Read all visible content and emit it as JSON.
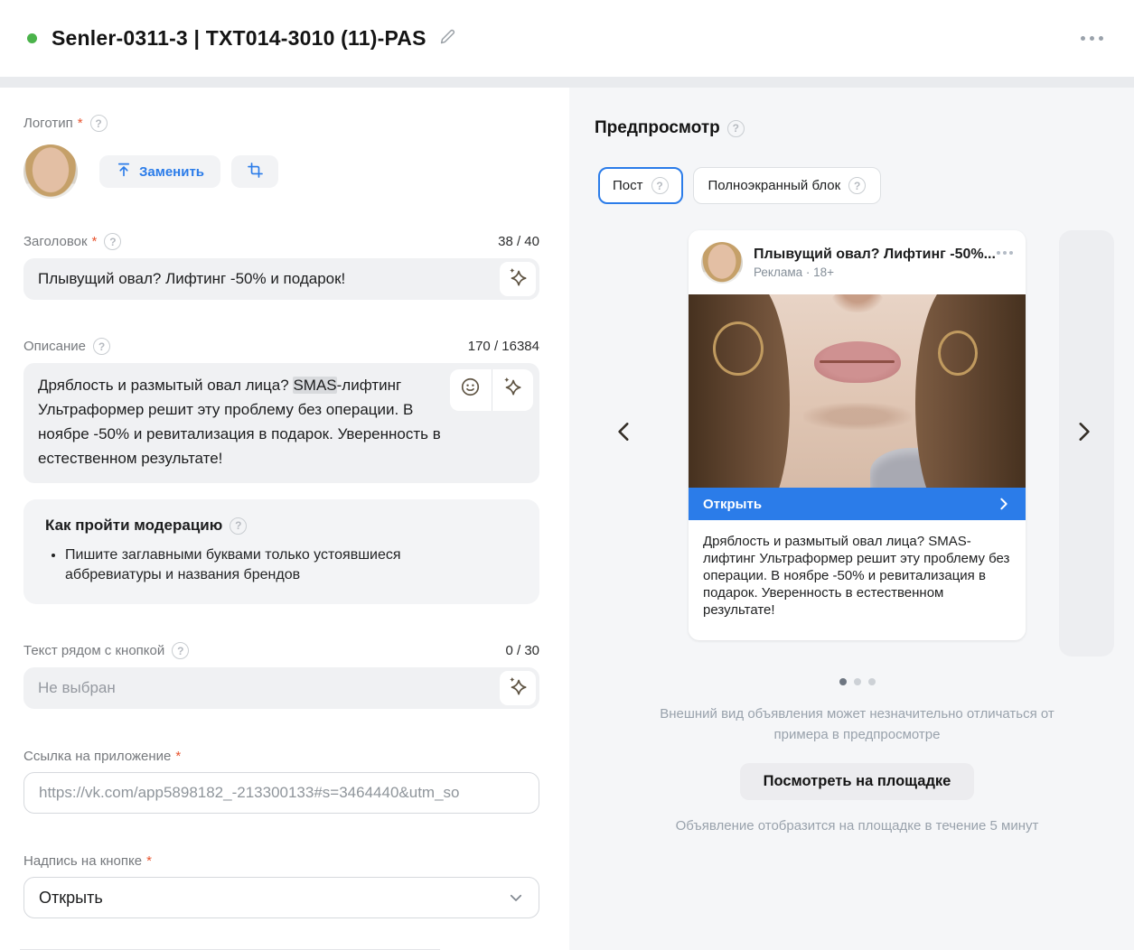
{
  "header": {
    "title": "Senler-0311-3 | TXT014-3010 (11)-PAS"
  },
  "icons": {
    "help": "?"
  },
  "form": {
    "logo": {
      "label": "Логотип",
      "required": "*",
      "replace_button": "Заменить"
    },
    "title_field": {
      "label": "Заголовок",
      "required": "*",
      "counter": "38 / 40",
      "value": "Плывущий овал? Лифтинг -50% и подарок!"
    },
    "description_field": {
      "label": "Описание",
      "counter": "170 / 16384",
      "text_before": "Дряблость и размытый овал лица? ",
      "text_highlight": "SMAS",
      "text_after": "-лифтинг Ультраформер решит эту проблему без операции. В ноябре -50% и ревитализация в подарок. Уверенность в естественном результате!"
    },
    "moderation": {
      "title": "Как пройти модерацию",
      "bullet": "Пишите заглавными буквами только устоявшиеся аббревиатуры и названия брендов"
    },
    "button_text_field": {
      "label": "Текст рядом с кнопкой",
      "counter": "0 / 30",
      "placeholder": "Не выбран"
    },
    "link_field": {
      "label": "Ссылка на приложение",
      "required": "*",
      "value": "https://vk.com/app5898182_-213300133#s=3464440&utm_so"
    },
    "button_label_field": {
      "label": "Надпись на кнопке",
      "required": "*",
      "value": "Открыть"
    }
  },
  "preview": {
    "title": "Предпросмотр",
    "tabs": [
      {
        "label": "Пост"
      },
      {
        "label": "Полноэкранный блок"
      }
    ],
    "card": {
      "title": "Плывущий овал? Лифтинг -50%...",
      "subtitle": "Реклама · 18+",
      "button_label": "Открыть",
      "description": "Дряблость и размытый овал лица? SMAS-лифтинг Ультраформер решит эту проблему без операции. В ноябре -50% и ревитализация в подарок. Уверенность в естественном результате!"
    },
    "disclaimer": "Внешний вид объявления может незначительно отличаться от примера в предпросмотре",
    "view_button": "Посмотреть на площадке",
    "note": "Объявление отобразится на площадке в течение 5 минут"
  },
  "colors": {
    "accent_blue": "#2b7ce9",
    "status_green": "#4bb34b",
    "required_red": "#e8542f"
  }
}
